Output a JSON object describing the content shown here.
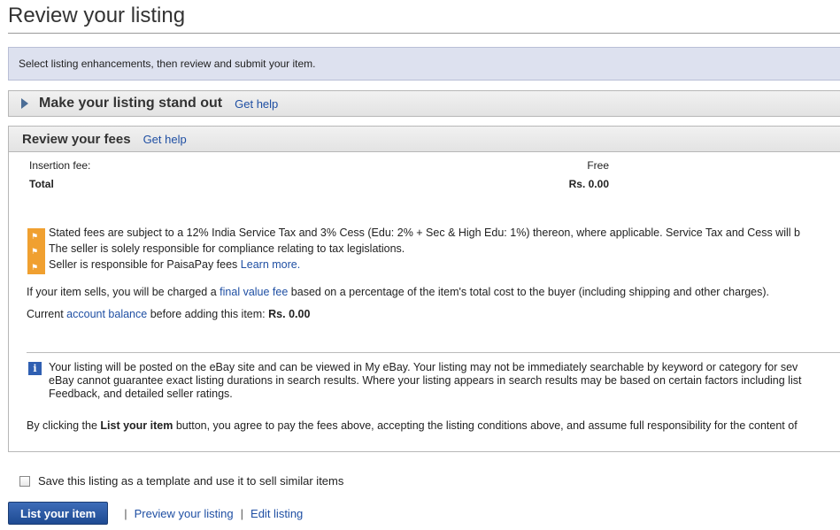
{
  "page": {
    "title": "Review your listing",
    "instruction": "Select listing enhancements, then review and submit your item."
  },
  "standout": {
    "title": "Make your listing stand out",
    "help": "Get help"
  },
  "fees": {
    "title": "Review your fees",
    "help": "Get help",
    "rows": [
      {
        "label": "Insertion fee:",
        "value": "Free"
      },
      {
        "label": "Total",
        "value": "Rs. 0.00"
      }
    ],
    "notices": [
      {
        "text": "Stated fees are subject to a 12% India Service Tax and 3% Cess (Edu: 2% + Sec & High Edu: 1%) thereon, where applicable. Service Tax and Cess will b"
      },
      {
        "text": "The seller is solely responsible for compliance relating to tax legislations."
      },
      {
        "text": "Seller is responsible for PaisaPay fees",
        "link": "Learn more."
      }
    ],
    "final_value": {
      "before": "If your item sells, you will be charged a",
      "link": "final value fee",
      "after": "based on a percentage of the item's total cost to the buyer (including shipping and other charges)."
    },
    "balance": {
      "before": "Current",
      "link": "account balance",
      "after": "before adding this item:",
      "amount": "Rs. 0.00"
    },
    "info_lines": [
      "Your listing will be posted on the eBay site and can be viewed in My eBay. Your listing may not be immediately searchable by keyword or category for sev",
      "eBay cannot guarantee exact listing durations in search results. Where your listing appears in search results may be based on certain factors including list",
      "Feedback, and detailed seller ratings."
    ],
    "agree": {
      "before": "By clicking the",
      "bold": "List your item",
      "after": "button, you agree to pay the fees above, accepting the listing conditions above, and assume full responsibility for the content of"
    }
  },
  "template_checkbox": {
    "label": "Save this listing as a template and use it to sell similar items",
    "checked": false
  },
  "actions": {
    "list_button": "List your item",
    "separator": "|",
    "preview": "Preview your listing",
    "edit": "Edit listing"
  },
  "icons": {
    "expand": "triangle-right-icon",
    "flag": "flag-icon",
    "info": "info-icon"
  },
  "colors": {
    "link": "#1f4fa3",
    "flag": "#f0a030",
    "info": "#2f5fb2",
    "button": "#1e4a92"
  }
}
